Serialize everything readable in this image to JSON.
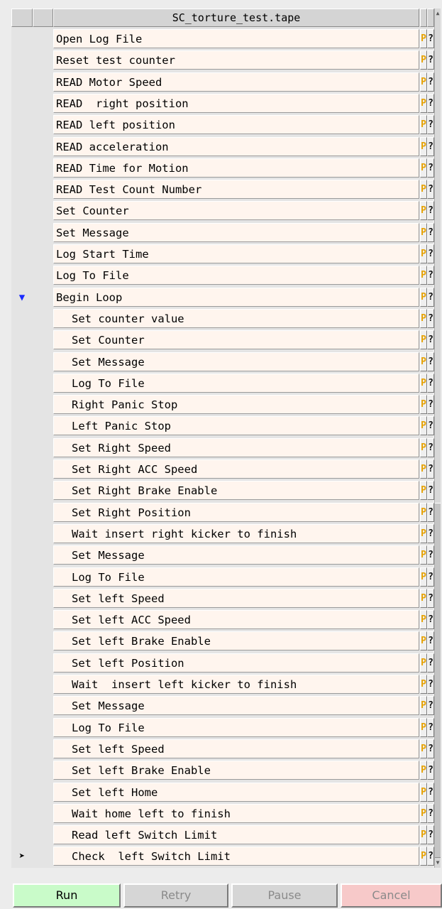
{
  "title": "SC_torture_test.tape",
  "rows": [
    {
      "label": "Open Log File",
      "indent": false,
      "marker": ""
    },
    {
      "label": "Reset test counter",
      "indent": false,
      "marker": ""
    },
    {
      "label": "READ Motor Speed",
      "indent": false,
      "marker": ""
    },
    {
      "label": "READ  right position",
      "indent": false,
      "marker": ""
    },
    {
      "label": "READ left position",
      "indent": false,
      "marker": ""
    },
    {
      "label": "READ acceleration",
      "indent": false,
      "marker": ""
    },
    {
      "label": "READ Time for Motion",
      "indent": false,
      "marker": ""
    },
    {
      "label": "READ Test Count Number",
      "indent": false,
      "marker": ""
    },
    {
      "label": "Set Counter",
      "indent": false,
      "marker": ""
    },
    {
      "label": "Set Message",
      "indent": false,
      "marker": ""
    },
    {
      "label": "Log Start Time",
      "indent": false,
      "marker": ""
    },
    {
      "label": "Log To File",
      "indent": false,
      "marker": ""
    },
    {
      "label": "Begin Loop",
      "indent": false,
      "marker": "loop"
    },
    {
      "label": "Set counter value",
      "indent": true,
      "marker": ""
    },
    {
      "label": "Set Counter",
      "indent": true,
      "marker": ""
    },
    {
      "label": "Set Message",
      "indent": true,
      "marker": ""
    },
    {
      "label": "Log To File",
      "indent": true,
      "marker": ""
    },
    {
      "label": "Right Panic Stop",
      "indent": true,
      "marker": ""
    },
    {
      "label": "Left Panic Stop",
      "indent": true,
      "marker": ""
    },
    {
      "label": "Set Right Speed",
      "indent": true,
      "marker": ""
    },
    {
      "label": "Set Right ACC Speed",
      "indent": true,
      "marker": ""
    },
    {
      "label": "Set Right Brake Enable",
      "indent": true,
      "marker": ""
    },
    {
      "label": "Set Right Position",
      "indent": true,
      "marker": ""
    },
    {
      "label": "Wait insert right kicker to finish",
      "indent": true,
      "marker": ""
    },
    {
      "label": "Set Message",
      "indent": true,
      "marker": ""
    },
    {
      "label": "Log To File",
      "indent": true,
      "marker": ""
    },
    {
      "label": "Set left Speed",
      "indent": true,
      "marker": ""
    },
    {
      "label": "Set left ACC Speed",
      "indent": true,
      "marker": ""
    },
    {
      "label": "Set left Brake Enable",
      "indent": true,
      "marker": ""
    },
    {
      "label": "Set left Position",
      "indent": true,
      "marker": ""
    },
    {
      "label": "Wait  insert left kicker to finish",
      "indent": true,
      "marker": ""
    },
    {
      "label": "Set Message",
      "indent": true,
      "marker": ""
    },
    {
      "label": "Log To File",
      "indent": true,
      "marker": ""
    },
    {
      "label": "Set left Speed",
      "indent": true,
      "marker": ""
    },
    {
      "label": "Set left Brake Enable",
      "indent": true,
      "marker": ""
    },
    {
      "label": "Set left Home",
      "indent": true,
      "marker": ""
    },
    {
      "label": "Wait home left to finish",
      "indent": true,
      "marker": ""
    },
    {
      "label": "Read left Switch Limit",
      "indent": true,
      "marker": ""
    },
    {
      "label": "Check  left Switch Limit",
      "indent": true,
      "marker": "current"
    }
  ],
  "row_buttons": {
    "p_label": "P",
    "q_label": "?"
  },
  "markers": {
    "loop_icon": "down-arrow-icon",
    "current_icon": "play-pointer-icon"
  },
  "actions": {
    "run": "Run",
    "retry": "Retry",
    "pause": "Pause",
    "cancel": "Cancel"
  },
  "colors": {
    "row_bg": "#fff5ee",
    "p_color": "#e6a100",
    "loop_marker": "#1a2cff",
    "run_bg": "#c9fbc9",
    "cancel_bg": "#f7c9c9"
  }
}
